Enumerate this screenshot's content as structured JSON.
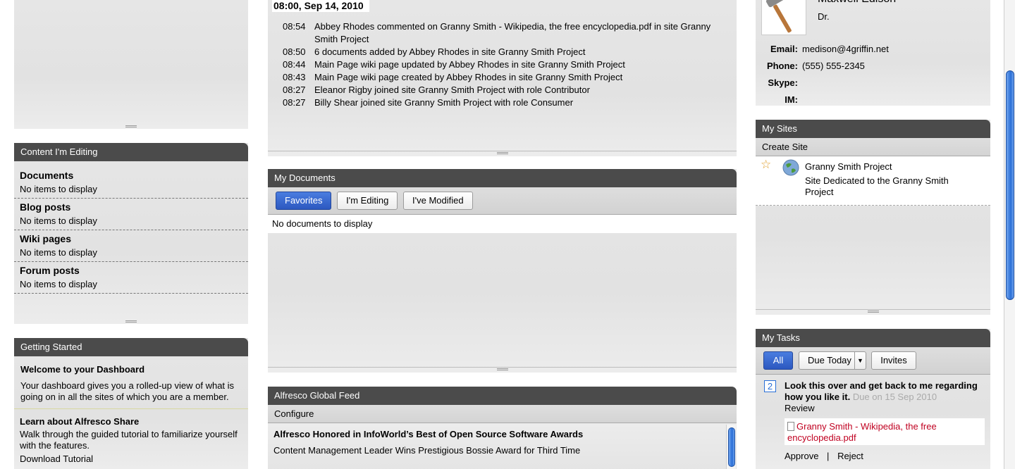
{
  "left": {
    "content_editing": {
      "title": "Content I'm Editing",
      "sections": [
        {
          "heading": "Documents",
          "empty": "No items to display"
        },
        {
          "heading": "Blog posts",
          "empty": "No items to display"
        },
        {
          "heading": "Wiki pages",
          "empty": "No items to display"
        },
        {
          "heading": "Forum posts",
          "empty": "No items to display"
        }
      ]
    },
    "getting_started": {
      "title": "Getting Started",
      "welcome_heading": "Welcome to your Dashboard",
      "welcome_text": "Your dashboard gives you a rolled-up view of what is going on in all the sites of which you are a member.",
      "learn_heading": "Learn about Alfresco Share",
      "learn_text": "Walk through the guided tutorial to familiarize yourself with the features.",
      "download_link": "Download Tutorial"
    }
  },
  "center": {
    "activities": {
      "date_header": "08:00, Sep 14, 2010",
      "items": [
        {
          "time": "08:54",
          "text": "Abbey Rhodes commented on Granny Smith - Wikipedia, the free encyclopedia.pdf in site Granny Smith Project"
        },
        {
          "time": "08:50",
          "text": "6 documents added by Abbey Rhodes in site Granny Smith Project"
        },
        {
          "time": "08:44",
          "text": "Main Page wiki page updated by Abbey Rhodes in site Granny Smith Project"
        },
        {
          "time": "08:43",
          "text": "Main Page wiki page created by Abbey Rhodes in site Granny Smith Project"
        },
        {
          "time": "08:27",
          "text": "Eleanor Rigby joined site Granny Smith Project with role Contributor"
        },
        {
          "time": "08:27",
          "text": "Billy Shear joined site Granny Smith Project with role Consumer"
        }
      ]
    },
    "my_documents": {
      "title": "My Documents",
      "filters": [
        "Favorites",
        "I'm Editing",
        "I've Modified"
      ],
      "empty": "No documents to display"
    },
    "global_feed": {
      "title": "Alfresco Global Feed",
      "configure": "Configure",
      "headline": "Alfresco Honored in InfoWorld’s Best of Open Source Software Awards",
      "subline": "Content Management Leader Wins Prestigious Bossie Award for Third Time"
    }
  },
  "right": {
    "profile": {
      "name": "Maxwell Edison",
      "title": "Dr.",
      "email_label": "Email:",
      "email": "medison@4griffin.net",
      "phone_label": "Phone:",
      "phone": "(555) 555-2345",
      "skype_label": "Skype:",
      "im_label": "IM:"
    },
    "my_sites": {
      "title": "My Sites",
      "create": "Create Site",
      "site_name": "Granny Smith Project",
      "site_desc": "Site Dedicated to the Granny Smith Project"
    },
    "my_tasks": {
      "title": "My Tasks",
      "filters": [
        "All",
        "Due Today",
        "Invites"
      ],
      "task_priority": "2",
      "task_title": "Look this over and get back to me regarding how you like it.",
      "task_due": "Due on 15 Sep 2010",
      "task_type": "Review",
      "task_doc": "Granny Smith - Wikipedia, the free encyclopedia.pdf",
      "approve": "Approve",
      "separator": "|",
      "reject": "Reject"
    }
  }
}
